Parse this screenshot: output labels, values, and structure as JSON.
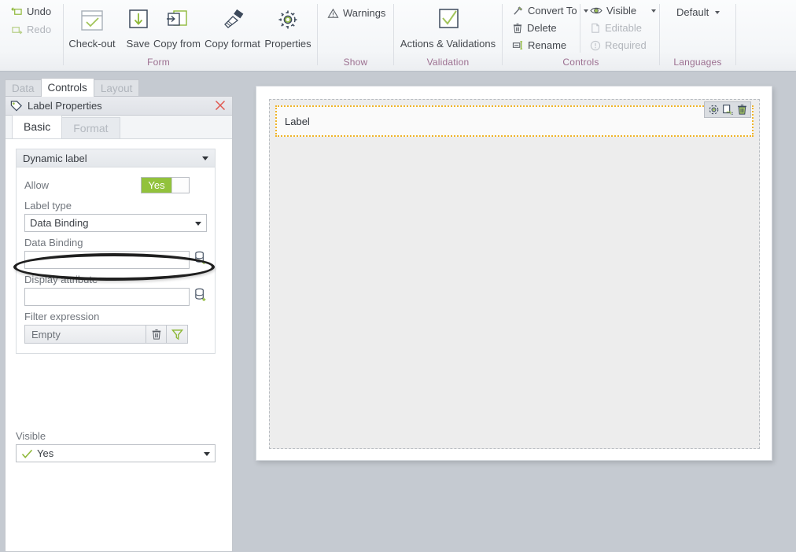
{
  "ribbon": {
    "groups": [
      {
        "name": "Form",
        "label": "Form"
      },
      {
        "name": "Show",
        "label": "Show"
      },
      {
        "name": "Validation",
        "label": "Validation"
      },
      {
        "name": "Controls",
        "label": "Controls"
      },
      {
        "name": "Languages",
        "label": "Languages"
      }
    ],
    "undo": "Undo",
    "redo": "Redo",
    "checkout": "Check-out",
    "save": "Save",
    "copy_from": "Copy from",
    "copy_format": "Copy format",
    "properties": "Properties",
    "warnings": "Warnings",
    "actions_validations": "Actions & Validations",
    "convert_to": "Convert To",
    "delete": "Delete",
    "rename": "Rename",
    "visible": "Visible",
    "editable": "Editable",
    "required": "Required",
    "default_language": "Default"
  },
  "panel": {
    "tabs": [
      {
        "label": "Data",
        "active": false
      },
      {
        "label": "Controls",
        "active": true
      },
      {
        "label": "Layout",
        "active": false
      }
    ],
    "title": "Label Properties",
    "subtabs": [
      {
        "label": "Basic",
        "active": true
      },
      {
        "label": "Format",
        "active": false
      }
    ],
    "section": {
      "header": "Dynamic label",
      "allow_label": "Allow",
      "allow_value": "Yes",
      "label_type_label": "Label type",
      "label_type_value": "Data Binding",
      "data_binding_label": "Data Binding",
      "data_binding_value": "",
      "display_attribute_label": "Display attribute",
      "display_attribute_value": "",
      "filter_expression_label": "Filter expression",
      "filter_expression_value": "Empty"
    },
    "visible_label": "Visible",
    "visible_value": "Yes"
  },
  "canvas": {
    "label_text": "Label"
  },
  "colors": {
    "accent_green": "#92c23c",
    "group_label": "#9c6f90",
    "selection_orange": "#f0b429",
    "close_red": "#e0574f"
  }
}
